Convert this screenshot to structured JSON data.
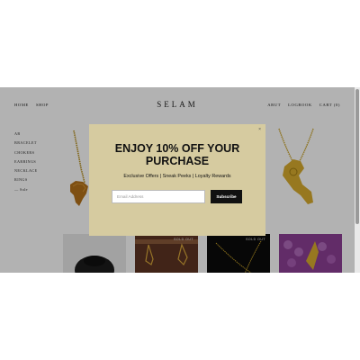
{
  "header": {
    "brand": "SELAM",
    "left_links": [
      "HOME",
      "SHOP"
    ],
    "right_links": [
      "ABUT",
      "LOGBOOK",
      "CART (0)"
    ]
  },
  "sidebar": {
    "items": [
      "AB",
      "BRACELET",
      "CHOKERS",
      "EARRINGS",
      "NECKLACE",
      "RINGS",
      "— Sale"
    ]
  },
  "thumbnails": [
    {
      "tag": ""
    },
    {
      "tag": "SOLD OUT"
    },
    {
      "tag": "SOLD OUT"
    },
    {
      "tag": ""
    }
  ],
  "popup": {
    "close": "×",
    "title_line1": "ENJOY 10% OFF YOUR",
    "title_line2": "PURCHASE",
    "subtitle": "Exclusive Offers | Sneak Peeks | Loyalty Rewards",
    "email_placeholder": "Email Address",
    "subscribe_label": "Subscribe"
  },
  "colors": {
    "popup_bg": "#d6cba0",
    "button_bg": "#111111",
    "gold": "#c9a227"
  }
}
